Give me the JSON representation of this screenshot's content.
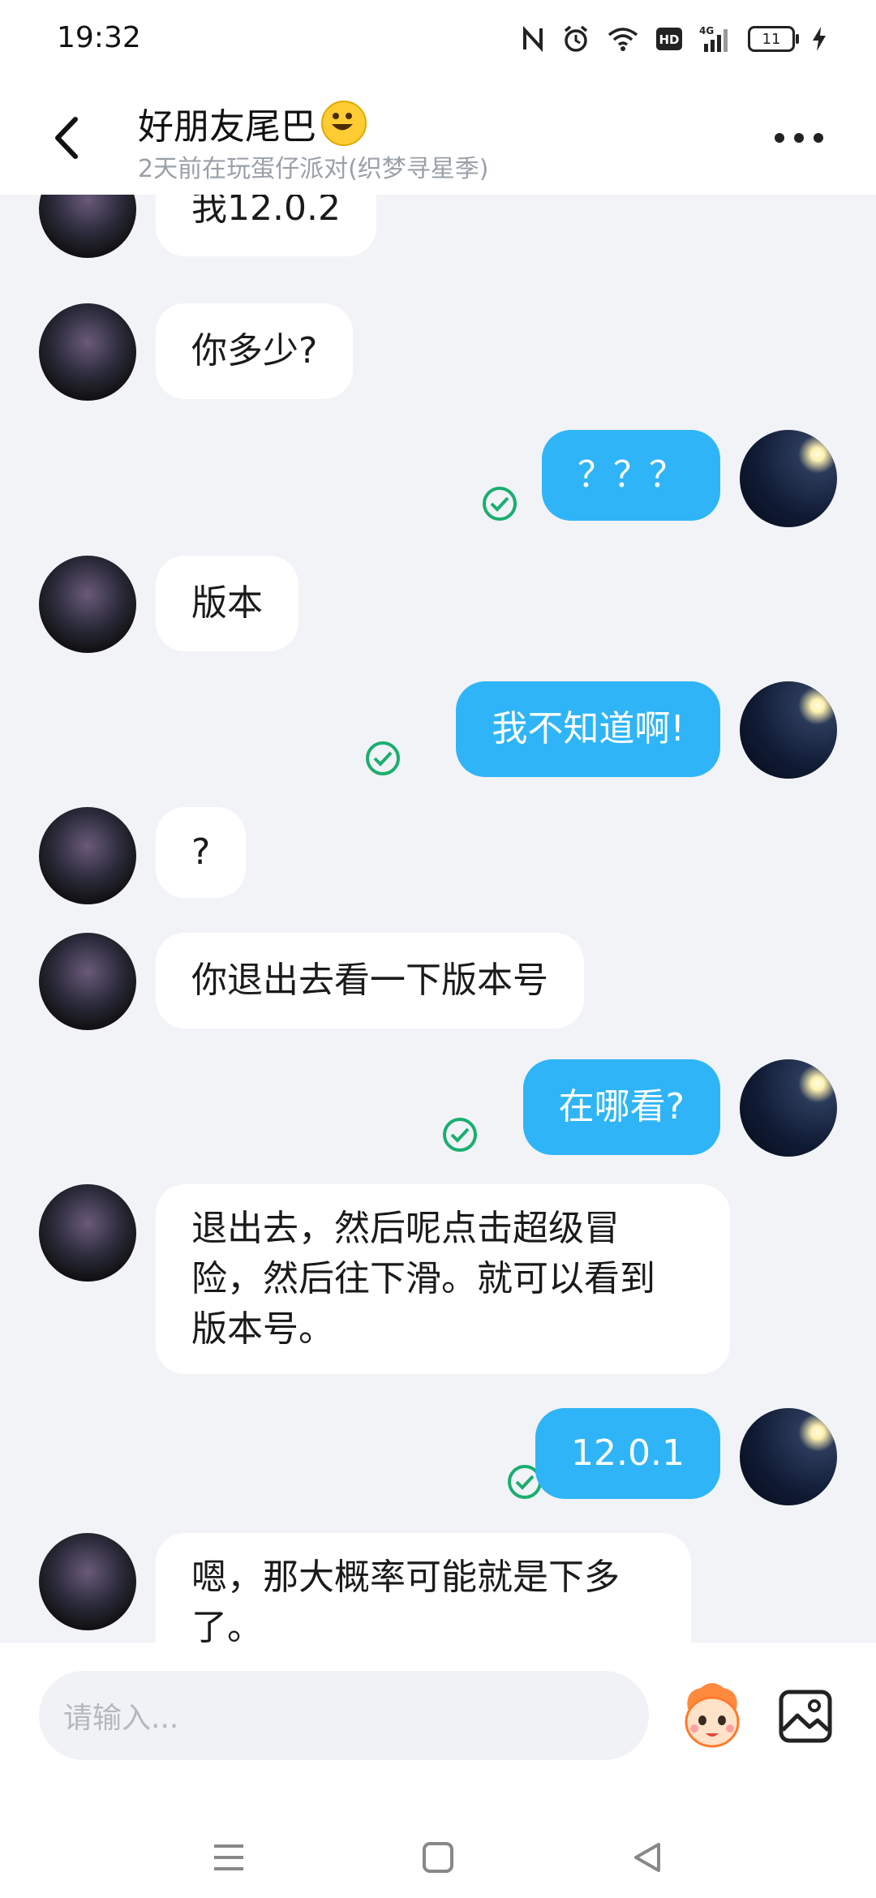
{
  "status": {
    "time": "19:32",
    "battery": "11",
    "icons": [
      "nfc-icon",
      "alarm-icon",
      "wifi-icon",
      "hd-icon",
      "signal-4g-icon",
      "battery-icon",
      "charging-icon"
    ]
  },
  "header": {
    "title": "好朋友尾巴",
    "subtitle": "2天前在玩蛋仔派对(织梦寻星季)"
  },
  "messages": [
    {
      "from": "friend",
      "text": "我12.0.2"
    },
    {
      "from": "friend",
      "text": "你多少?"
    },
    {
      "from": "me",
      "text": "？？？",
      "read": true
    },
    {
      "from": "friend",
      "text": "版本"
    },
    {
      "from": "me",
      "text": "我不知道啊!",
      "read": true
    },
    {
      "from": "friend",
      "text": "?"
    },
    {
      "from": "friend",
      "text": "你退出去看一下版本号"
    },
    {
      "from": "me",
      "text": "在哪看?",
      "read": true
    },
    {
      "from": "friend",
      "lines": [
        "退出去，然后呢点击超级冒",
        "险，然后往下滑。就可以看到",
        "版本号。"
      ]
    },
    {
      "from": "me",
      "text": "12.0.1",
      "read": true
    },
    {
      "from": "friend",
      "lines": [
        "嗯，那大概率可能就是下多",
        "了。"
      ]
    }
  ],
  "input": {
    "placeholder": "请输入..."
  },
  "colors": {
    "outgoing_bubble": "#2fb5f7",
    "incoming_bubble": "#ffffff",
    "read_check": "#1aae6f",
    "background": "#f2f3f7"
  }
}
